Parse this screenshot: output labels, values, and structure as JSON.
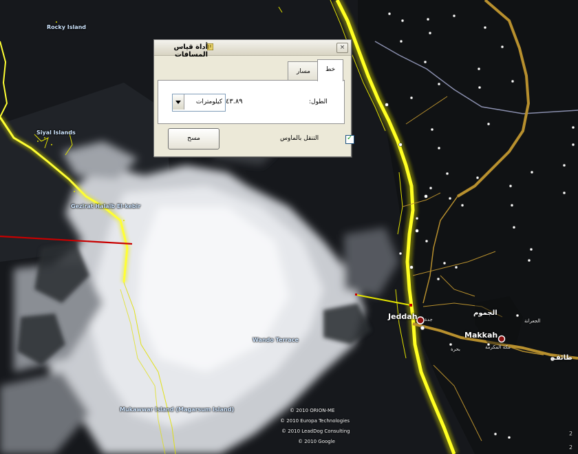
{
  "dialog": {
    "title": "أداة قياس المسافات",
    "close_label": "×",
    "tabs": [
      {
        "label": "خط",
        "active": true
      },
      {
        "label": "مسار",
        "active": false
      }
    ],
    "length_label": "الطول:",
    "length_value": "٤٣.٨٩",
    "unit_selected": "كيلومترات",
    "mouse_nav_label": "التنقل بالماوس",
    "mouse_nav_checked": true,
    "clear_button": "مسح"
  },
  "map": {
    "labels_en": {
      "rocky_island": "Rocky Island",
      "siyal_islands": "Siyal Islands",
      "gezirat_halaib": "Gezirat Halaib El-kebir",
      "wando_terrace": "Wando Terrace",
      "mukawwar_island": "Mukawwar Island (Magarsum Island)",
      "jeddah": "Jeddah",
      "makkah": "Makkah"
    },
    "labels_ar": {
      "jeddah": "جدة",
      "makkah_big": "الجموم",
      "taif": "طائف",
      "makkah_sub": "مكة المكرمة",
      "bahra": "بحرة",
      "jumum": "الجعرانة"
    },
    "credits": [
      "© 2010 ORION-ME",
      "© 2010 Europa Technologies",
      "© 2010 LeadDog Consulting",
      "© 2010 Google"
    ],
    "tile_numbers": [
      "2",
      "2"
    ],
    "colors": {
      "coastline": "#e8e800",
      "road": "#b8902e",
      "measure_long": "#c80000",
      "measure_short": "#e6e600",
      "border_line": "#8a8fae"
    }
  }
}
